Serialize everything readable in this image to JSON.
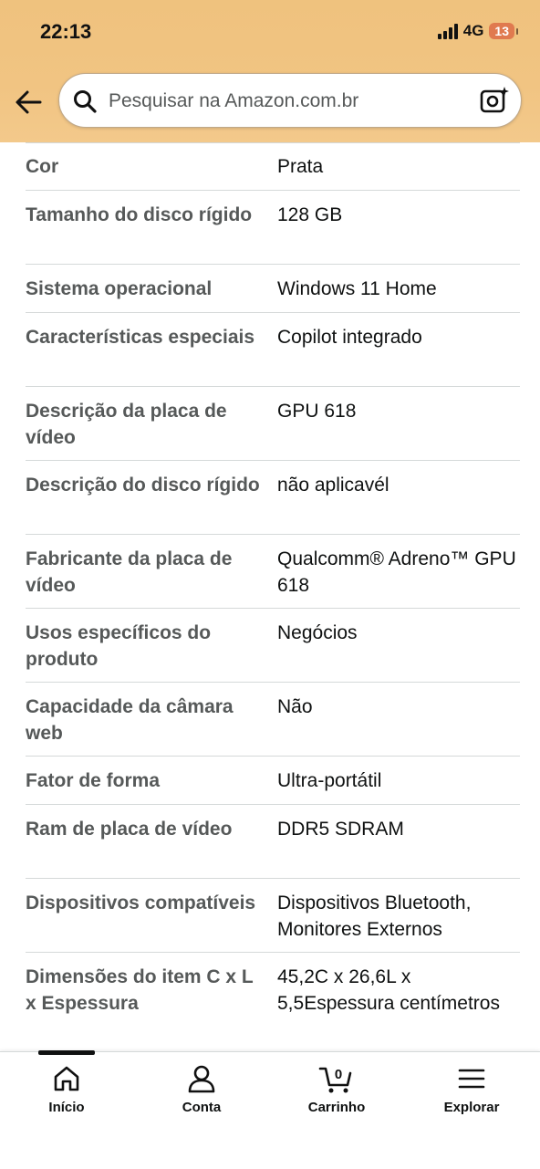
{
  "status": {
    "time": "22:13",
    "network": "4G",
    "battery": "13"
  },
  "search": {
    "placeholder": "Pesquisar na Amazon.com.br"
  },
  "specs": [
    {
      "key": "Cor",
      "value": "Prata"
    },
    {
      "key": "Tamanho do disco rígido",
      "value": "128 GB"
    },
    {
      "key": "Sistema operacional",
      "value": "Windows 11 Home"
    },
    {
      "key": "Características especiais",
      "value": "Copilot integrado"
    },
    {
      "key": "Descrição da placa de vídeo",
      "value": "GPU 618"
    },
    {
      "key": "Descrição do disco rígido",
      "value": "não aplicavél"
    },
    {
      "key": "Fabricante da placa de vídeo",
      "value": "Qualcomm® Adreno™ GPU 618"
    },
    {
      "key": "Usos específicos do produto",
      "value": "Negócios"
    },
    {
      "key": "Capacidade da câmara web",
      "value": "Não"
    },
    {
      "key": "Fator de forma",
      "value": "Ultra-portátil"
    },
    {
      "key": "Ram de placa de vídeo",
      "value": "DDR5 SDRAM"
    },
    {
      "key": "Dispositivos compatíveis",
      "value": "Dispositivos Bluetooth, Monitores Externos"
    },
    {
      "key": "Dimensões do item C x L x Espessura",
      "value": "45,2C x 26,6L x 5,5Espessura centímetros"
    }
  ],
  "nav": {
    "home": "Início",
    "account": "Conta",
    "cart": "Carrinho",
    "cart_count": "0",
    "explore": "Explorar"
  }
}
